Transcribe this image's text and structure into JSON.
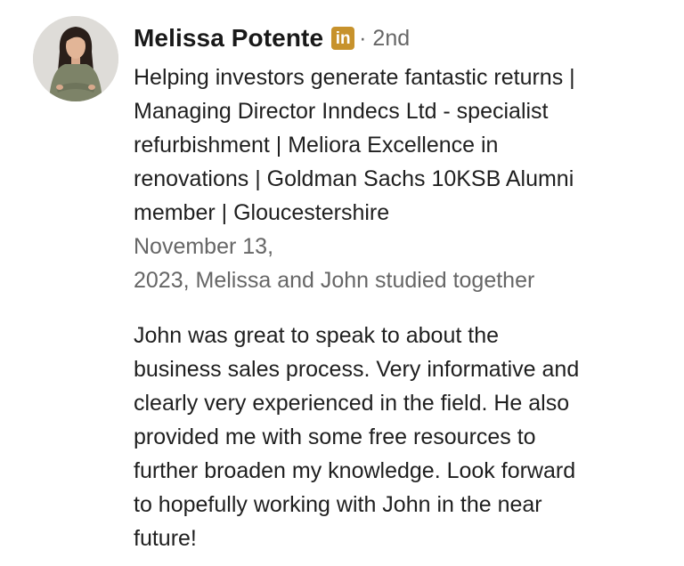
{
  "recommendation": {
    "author": {
      "name": "Melissa Potente",
      "network_badge": "in",
      "degree": "· 2nd",
      "headline_lines": [
        "Helping investors generate fantastic returns |",
        "Managing Director Inndecs Ltd - specialist",
        "refurbishment | Meliora Excellence in",
        "renovations | Goldman Sachs 10KSB Alumni",
        "member | Gloucestershire"
      ]
    },
    "meta_lines": [
      "November 13,",
      "2023, Melissa and John studied together"
    ],
    "text_lines": [
      "John was great to speak to about the",
      "business sales process. Very informative and",
      "clearly very experienced in the field. He also",
      "provided me with some free resources to",
      "further broaden my knowledge. Look forward",
      "to hopefully working with John in the near",
      "future!"
    ]
  },
  "colors": {
    "badge": "#c7922c",
    "secondary_text": "#666666",
    "primary_text": "#1f1f1f"
  }
}
